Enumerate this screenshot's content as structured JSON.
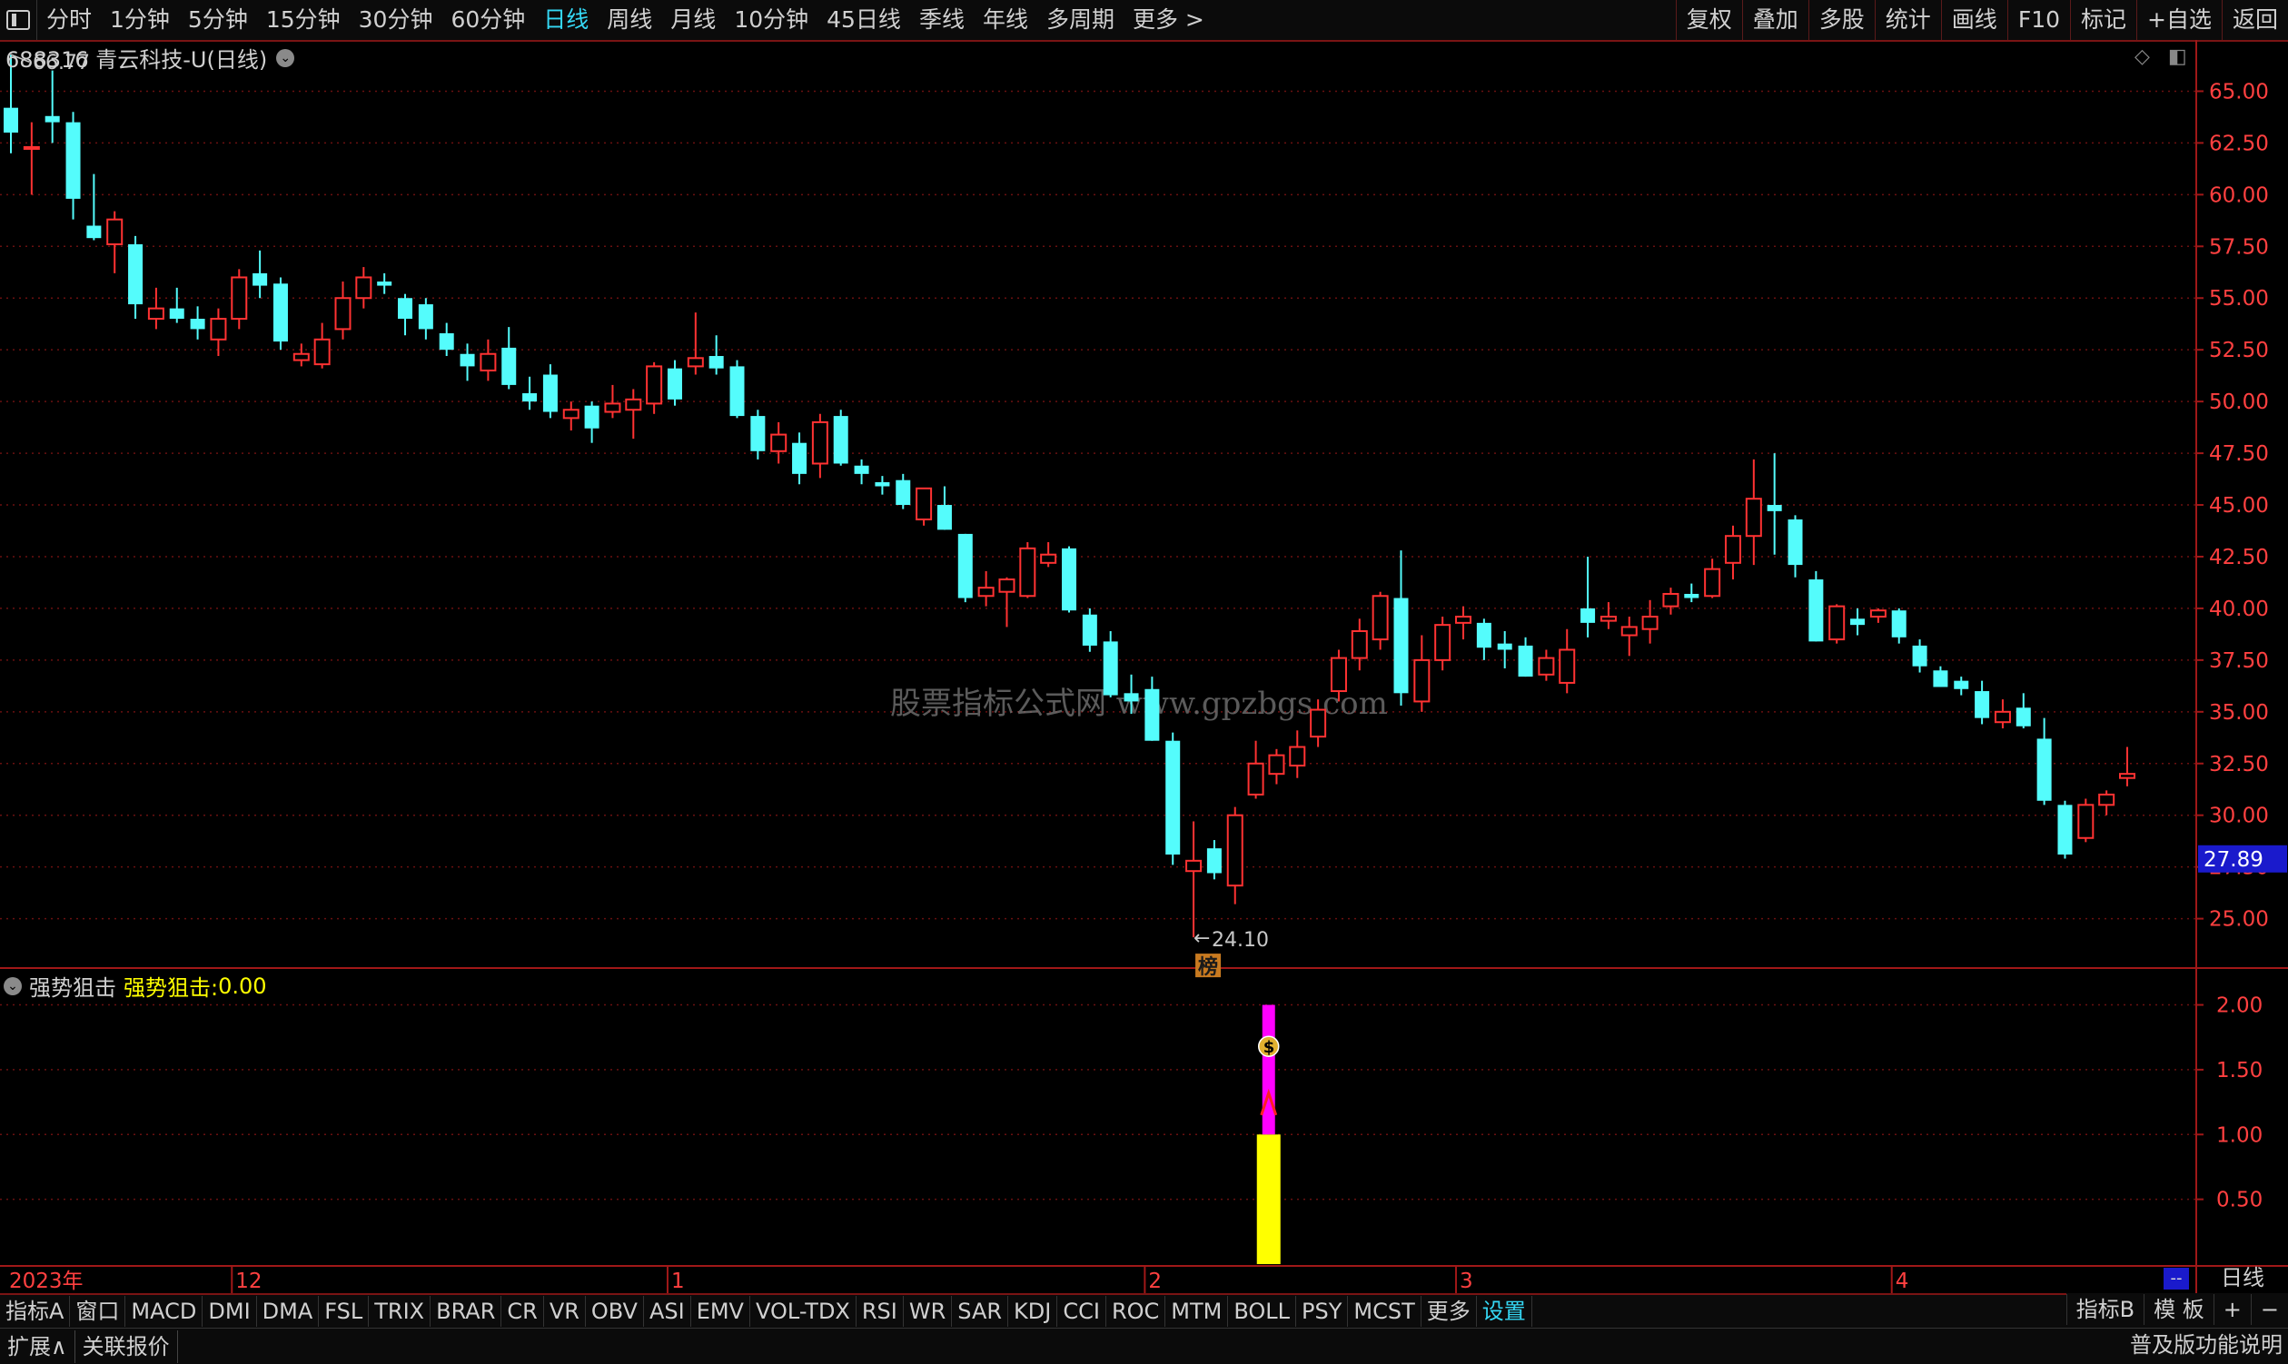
{
  "toolbar": {
    "periods": [
      "分时",
      "1分钟",
      "5分钟",
      "15分钟",
      "30分钟",
      "60分钟",
      "日线",
      "周线",
      "月线",
      "10分钟",
      "45日线",
      "季线",
      "年线",
      "多周期",
      "更多 >"
    ],
    "active_period": "日线",
    "right_items": [
      "复权",
      "叠加",
      "多股",
      "统计",
      "画线",
      "F10",
      "标记",
      "+自选",
      "返回"
    ]
  },
  "stock": {
    "title": "688316 青云科技-U(日线)"
  },
  "watermark": "股票指标公式网 www.gpzbgs.com",
  "main_chart": {
    "price_axis": [
      "65.00",
      "62.50",
      "60.00",
      "57.50",
      "55.00",
      "52.50",
      "50.00",
      "47.50",
      "45.00",
      "42.50",
      "40.00",
      "37.50",
      "35.00",
      "32.50",
      "30.00",
      "27.50",
      "25.00"
    ],
    "price_min": 22.7,
    "price_max": 66.6,
    "current_price": "27.89",
    "high_label": "66.77",
    "low_label": "24.10",
    "badge": "榜"
  },
  "indicator": {
    "name": "强势狙击",
    "value_label": "强势狙击:",
    "value": "0.00",
    "axis": [
      "2.00",
      "1.50",
      "1.00",
      "0.50"
    ],
    "coin_icon": "$"
  },
  "time_axis": {
    "labels": [
      "2023年",
      "12",
      "1",
      "2",
      "3",
      "4"
    ],
    "period": "日线",
    "dash": "--"
  },
  "bottom_tabs": [
    "指标A",
    "窗口",
    "MACD",
    "DMI",
    "DMA",
    "FSL",
    "TRIX",
    "BRAR",
    "CR",
    "VR",
    "OBV",
    "ASI",
    "EMV",
    "VOL-TDX",
    "RSI",
    "WR",
    "SAR",
    "KDJ",
    "CCI",
    "ROC",
    "MTM",
    "BOLL",
    "PSY",
    "MCST",
    "更多",
    "设置"
  ],
  "bottom_right": [
    "指标B",
    "模 板",
    "+",
    "−"
  ],
  "status": {
    "left": [
      "扩展∧",
      "关联报价"
    ],
    "right": "普及版功能说明"
  },
  "colors": {
    "up": "#ff3232",
    "down": "#54fcfc",
    "grid": "#6a1010",
    "accent": "#35d8f5",
    "yellow": "#ffff00",
    "magenta": "#ff00ff"
  },
  "chart_data": {
    "type": "candlestick",
    "candles": [
      {
        "o": 64.2,
        "h": 66.77,
        "l": 62.0,
        "c": 63.0
      },
      {
        "o": 62.3,
        "h": 63.5,
        "l": 60.0,
        "c": 62.3
      },
      {
        "o": 63.8,
        "h": 66.0,
        "l": 62.5,
        "c": 63.5
      },
      {
        "o": 63.5,
        "h": 64.0,
        "l": 58.8,
        "c": 59.8
      },
      {
        "o": 58.5,
        "h": 61.0,
        "l": 57.8,
        "c": 57.9
      },
      {
        "o": 57.6,
        "h": 59.2,
        "l": 56.2,
        "c": 58.8
      },
      {
        "o": 57.6,
        "h": 58.0,
        "l": 54.0,
        "c": 54.7
      },
      {
        "o": 54.0,
        "h": 55.5,
        "l": 53.5,
        "c": 54.5
      },
      {
        "o": 54.5,
        "h": 55.5,
        "l": 53.8,
        "c": 54.0
      },
      {
        "o": 54.0,
        "h": 54.6,
        "l": 53.0,
        "c": 53.5
      },
      {
        "o": 53.0,
        "h": 54.5,
        "l": 52.2,
        "c": 54.0
      },
      {
        "o": 54.0,
        "h": 56.4,
        "l": 53.5,
        "c": 56.0
      },
      {
        "o": 56.2,
        "h": 57.3,
        "l": 55.0,
        "c": 55.6
      },
      {
        "o": 55.7,
        "h": 56.0,
        "l": 52.5,
        "c": 52.9
      },
      {
        "o": 52.0,
        "h": 52.8,
        "l": 51.7,
        "c": 52.3
      },
      {
        "o": 51.8,
        "h": 53.8,
        "l": 51.6,
        "c": 53.0
      },
      {
        "o": 53.5,
        "h": 55.8,
        "l": 53.0,
        "c": 55.0
      },
      {
        "o": 55.0,
        "h": 56.5,
        "l": 54.5,
        "c": 56.0
      },
      {
        "o": 55.8,
        "h": 56.2,
        "l": 55.2,
        "c": 55.6
      },
      {
        "o": 55.0,
        "h": 55.2,
        "l": 53.2,
        "c": 54.0
      },
      {
        "o": 54.7,
        "h": 55.0,
        "l": 53.0,
        "c": 53.5
      },
      {
        "o": 53.3,
        "h": 53.8,
        "l": 52.2,
        "c": 52.5
      },
      {
        "o": 52.3,
        "h": 52.8,
        "l": 51.0,
        "c": 51.7
      },
      {
        "o": 51.5,
        "h": 53.0,
        "l": 51.0,
        "c": 52.3
      },
      {
        "o": 52.6,
        "h": 53.6,
        "l": 50.6,
        "c": 50.8
      },
      {
        "o": 50.4,
        "h": 51.2,
        "l": 49.6,
        "c": 50.0
      },
      {
        "o": 51.3,
        "h": 51.8,
        "l": 49.2,
        "c": 49.5
      },
      {
        "o": 49.2,
        "h": 50.0,
        "l": 48.6,
        "c": 49.6
      },
      {
        "o": 49.8,
        "h": 50.0,
        "l": 48.0,
        "c": 48.7
      },
      {
        "o": 49.5,
        "h": 50.8,
        "l": 49.2,
        "c": 49.9
      },
      {
        "o": 49.6,
        "h": 50.6,
        "l": 48.2,
        "c": 50.1
      },
      {
        "o": 49.9,
        "h": 51.9,
        "l": 49.4,
        "c": 51.7
      },
      {
        "o": 51.6,
        "h": 52.0,
        "l": 49.8,
        "c": 50.1
      },
      {
        "o": 51.7,
        "h": 54.3,
        "l": 51.3,
        "c": 52.1
      },
      {
        "o": 52.2,
        "h": 53.2,
        "l": 51.3,
        "c": 51.6
      },
      {
        "o": 51.7,
        "h": 52.0,
        "l": 49.2,
        "c": 49.3
      },
      {
        "o": 49.3,
        "h": 49.6,
        "l": 47.2,
        "c": 47.6
      },
      {
        "o": 47.6,
        "h": 49.0,
        "l": 47.0,
        "c": 48.4
      },
      {
        "o": 48.0,
        "h": 48.5,
        "l": 46.0,
        "c": 46.5
      },
      {
        "o": 47.0,
        "h": 49.4,
        "l": 46.3,
        "c": 49.0
      },
      {
        "o": 49.3,
        "h": 49.6,
        "l": 46.9,
        "c": 47.0
      },
      {
        "o": 46.9,
        "h": 47.2,
        "l": 46.0,
        "c": 46.5
      },
      {
        "o": 46.1,
        "h": 46.4,
        "l": 45.5,
        "c": 45.9
      },
      {
        "o": 46.2,
        "h": 46.5,
        "l": 44.8,
        "c": 45.0
      },
      {
        "o": 44.3,
        "h": 45.8,
        "l": 44.0,
        "c": 45.8
      },
      {
        "o": 45.0,
        "h": 45.9,
        "l": 43.8,
        "c": 43.8
      },
      {
        "o": 43.6,
        "h": 43.6,
        "l": 40.3,
        "c": 40.5
      },
      {
        "o": 40.6,
        "h": 41.8,
        "l": 40.1,
        "c": 41.0
      },
      {
        "o": 40.8,
        "h": 41.5,
        "l": 39.1,
        "c": 41.4
      },
      {
        "o": 40.6,
        "h": 43.2,
        "l": 40.5,
        "c": 42.9
      },
      {
        "o": 42.2,
        "h": 43.2,
        "l": 42.0,
        "c": 42.6
      },
      {
        "o": 42.9,
        "h": 43.0,
        "l": 39.8,
        "c": 39.9
      },
      {
        "o": 39.7,
        "h": 40.0,
        "l": 37.9,
        "c": 38.2
      },
      {
        "o": 38.4,
        "h": 38.9,
        "l": 35.7,
        "c": 35.8
      },
      {
        "o": 35.9,
        "h": 36.8,
        "l": 34.9,
        "c": 35.5
      },
      {
        "o": 36.1,
        "h": 36.7,
        "l": 33.6,
        "c": 33.6
      },
      {
        "o": 33.6,
        "h": 34.0,
        "l": 27.6,
        "c": 28.1
      },
      {
        "o": 27.3,
        "h": 29.7,
        "l": 24.1,
        "c": 27.8
      },
      {
        "o": 28.4,
        "h": 28.8,
        "l": 26.9,
        "c": 27.2
      },
      {
        "o": 26.6,
        "h": 30.4,
        "l": 25.7,
        "c": 30.0
      },
      {
        "o": 31.0,
        "h": 33.6,
        "l": 30.8,
        "c": 32.5
      },
      {
        "o": 32.0,
        "h": 33.2,
        "l": 31.5,
        "c": 32.9
      },
      {
        "o": 32.4,
        "h": 34.1,
        "l": 31.8,
        "c": 33.3
      },
      {
        "o": 33.8,
        "h": 35.6,
        "l": 33.3,
        "c": 35.1
      },
      {
        "o": 36.0,
        "h": 38.0,
        "l": 35.5,
        "c": 37.6
      },
      {
        "o": 37.6,
        "h": 39.5,
        "l": 37.0,
        "c": 38.9
      },
      {
        "o": 38.5,
        "h": 40.8,
        "l": 38.0,
        "c": 40.6
      },
      {
        "o": 40.5,
        "h": 42.8,
        "l": 35.3,
        "c": 35.9
      },
      {
        "o": 35.5,
        "h": 38.7,
        "l": 35.0,
        "c": 37.5
      },
      {
        "o": 37.5,
        "h": 39.6,
        "l": 37.0,
        "c": 39.2
      },
      {
        "o": 39.3,
        "h": 40.1,
        "l": 38.5,
        "c": 39.6
      },
      {
        "o": 39.3,
        "h": 39.5,
        "l": 37.5,
        "c": 38.1
      },
      {
        "o": 38.3,
        "h": 38.9,
        "l": 37.1,
        "c": 38.0
      },
      {
        "o": 38.2,
        "h": 38.6,
        "l": 36.7,
        "c": 36.7
      },
      {
        "o": 36.8,
        "h": 38.0,
        "l": 36.5,
        "c": 37.6
      },
      {
        "o": 36.4,
        "h": 39.0,
        "l": 35.9,
        "c": 38.0
      },
      {
        "o": 40.0,
        "h": 42.5,
        "l": 38.6,
        "c": 39.3
      },
      {
        "o": 39.4,
        "h": 40.3,
        "l": 39.0,
        "c": 39.6
      },
      {
        "o": 38.7,
        "h": 39.6,
        "l": 37.7,
        "c": 39.1
      },
      {
        "o": 39.0,
        "h": 40.4,
        "l": 38.3,
        "c": 39.6
      },
      {
        "o": 40.1,
        "h": 41.0,
        "l": 39.7,
        "c": 40.7
      },
      {
        "o": 40.7,
        "h": 41.2,
        "l": 40.3,
        "c": 40.5
      },
      {
        "o": 40.6,
        "h": 42.4,
        "l": 40.5,
        "c": 41.9
      },
      {
        "o": 42.2,
        "h": 44.0,
        "l": 41.4,
        "c": 43.5
      },
      {
        "o": 43.5,
        "h": 47.2,
        "l": 42.1,
        "c": 45.3
      },
      {
        "o": 45.0,
        "h": 47.5,
        "l": 42.6,
        "c": 44.7
      },
      {
        "o": 44.3,
        "h": 44.5,
        "l": 41.5,
        "c": 42.1
      },
      {
        "o": 41.4,
        "h": 41.8,
        "l": 38.4,
        "c": 38.4
      },
      {
        "o": 38.5,
        "h": 40.2,
        "l": 38.3,
        "c": 40.1
      },
      {
        "o": 39.5,
        "h": 40.0,
        "l": 38.7,
        "c": 39.2
      },
      {
        "o": 39.6,
        "h": 40.0,
        "l": 39.3,
        "c": 39.9
      },
      {
        "o": 39.9,
        "h": 40.0,
        "l": 38.3,
        "c": 38.6
      },
      {
        "o": 38.2,
        "h": 38.5,
        "l": 36.9,
        "c": 37.2
      },
      {
        "o": 37.0,
        "h": 37.2,
        "l": 36.2,
        "c": 36.2
      },
      {
        "o": 36.5,
        "h": 36.7,
        "l": 35.8,
        "c": 36.1
      },
      {
        "o": 36.0,
        "h": 36.5,
        "l": 34.4,
        "c": 34.7
      },
      {
        "o": 34.5,
        "h": 35.6,
        "l": 34.2,
        "c": 35.0
      },
      {
        "o": 35.2,
        "h": 35.9,
        "l": 34.2,
        "c": 34.3
      },
      {
        "o": 33.7,
        "h": 34.7,
        "l": 30.5,
        "c": 30.7
      },
      {
        "o": 30.5,
        "h": 30.7,
        "l": 27.9,
        "c": 28.1
      },
      {
        "o": 28.9,
        "h": 30.8,
        "l": 28.7,
        "c": 30.5
      },
      {
        "o": 30.5,
        "h": 31.2,
        "l": 30.0,
        "c": 31.0
      },
      {
        "o": 31.8,
        "h": 33.3,
        "l": 31.4,
        "c": 32.0
      }
    ],
    "indicator_signal": {
      "index": 59,
      "yellow": [
        0,
        1
      ],
      "magenta": [
        1,
        2
      ]
    },
    "indicator_range": [
      0,
      2.2
    ]
  }
}
